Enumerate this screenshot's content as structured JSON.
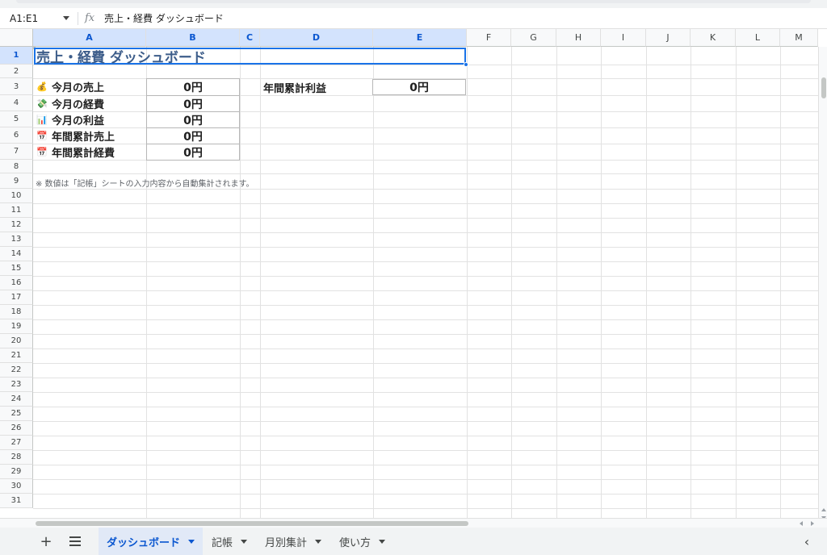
{
  "formula_bar": {
    "name_box": "A1:E1",
    "fx_symbol": "fx",
    "content": "売上・経費 ダッシュボード"
  },
  "columns": [
    "A",
    "B",
    "C",
    "D",
    "E",
    "F",
    "G",
    "H",
    "I",
    "J",
    "K",
    "L",
    "M"
  ],
  "selected_columns": [
    "A",
    "B",
    "C",
    "D",
    "E"
  ],
  "rows": [
    "1",
    "2",
    "3",
    "4",
    "5",
    "6",
    "7",
    "8",
    "9",
    "10",
    "11",
    "12",
    "13",
    "14",
    "15",
    "16",
    "17",
    "18",
    "19",
    "20",
    "21",
    "22",
    "23",
    "24",
    "25",
    "26",
    "27",
    "28",
    "29",
    "30",
    "31"
  ],
  "selected_row": "1",
  "sheet": {
    "title": "売上・経費 ダッシュボード",
    "title_color": "#3d5d8a",
    "metrics": [
      {
        "icon": "money-bag-icon",
        "glyph": "💰",
        "label": "今月の売上",
        "value": "0円"
      },
      {
        "icon": "money-wings-icon",
        "glyph": "💸",
        "label": "今月の経費",
        "value": "0円"
      },
      {
        "icon": "bar-chart-icon",
        "glyph": "📊",
        "label": "今月の利益",
        "value": "0円"
      },
      {
        "icon": "calendar-icon",
        "glyph": "📅",
        "label": "年間累計売上",
        "value": "0円"
      },
      {
        "icon": "calendar-icon",
        "glyph": "📅",
        "label": "年間累計経費",
        "value": "0円"
      }
    ],
    "annual_profit": {
      "label": "年間累計利益",
      "value": "0円"
    },
    "note": "※ 数値は「記帳」シートの入力内容から自動集計されます。"
  },
  "tabs": [
    {
      "label": "ダッシュボード",
      "active": true
    },
    {
      "label": "記帳",
      "active": false
    },
    {
      "label": "月別集計",
      "active": false
    },
    {
      "label": "使い方",
      "active": false
    }
  ],
  "tabbar": {
    "add_label": "+",
    "collapse_label": "‹"
  },
  "colors": {
    "selection": "#1a73e8",
    "header_selected": "#d3e3fd",
    "active_tab": "#e1e9f7"
  }
}
